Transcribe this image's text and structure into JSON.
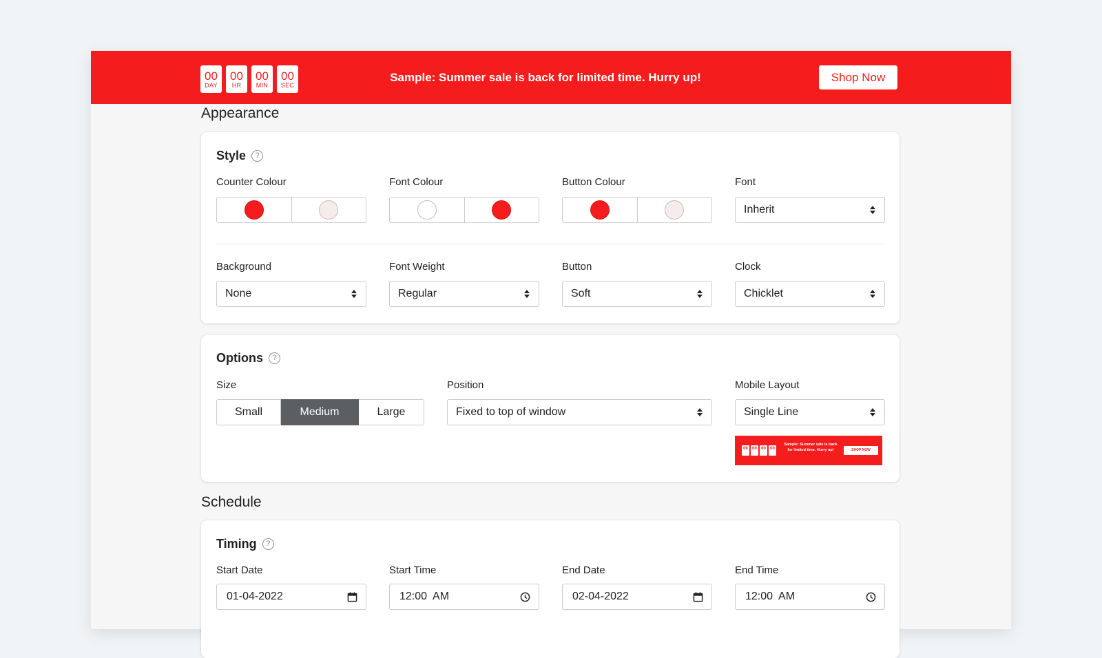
{
  "banner": {
    "counter": [
      {
        "value": "00",
        "unit": "DAY"
      },
      {
        "value": "00",
        "unit": "HR"
      },
      {
        "value": "00",
        "unit": "MIN"
      },
      {
        "value": "00",
        "unit": "SEC"
      }
    ],
    "message": "Sample: Summer sale is back for limited time. Hurry up!",
    "button_label": "Shop Now",
    "color": "#f41c1c"
  },
  "appearance": {
    "title": "Appearance",
    "style": {
      "title": "Style",
      "help_icon": "question-circle-icon",
      "counter_colour": {
        "label": "Counter Colour",
        "colors": [
          "#f41c1c",
          "#f7ecec"
        ]
      },
      "font_colour": {
        "label": "Font Colour",
        "colors": [
          "#ffffff",
          "#f41c1c"
        ]
      },
      "button_colour": {
        "label": "Button Colour",
        "colors": [
          "#f41c1c",
          "#f7ecec"
        ]
      },
      "font": {
        "label": "Font",
        "value": "Inherit"
      },
      "background": {
        "label": "Background",
        "value": "None"
      },
      "font_weight": {
        "label": "Font Weight",
        "value": "Regular"
      },
      "button": {
        "label": "Button",
        "value": "Soft"
      },
      "clock": {
        "label": "Clock",
        "value": "Chicklet"
      }
    },
    "options": {
      "title": "Options",
      "help_icon": "question-circle-icon",
      "size": {
        "label": "Size",
        "options": [
          "Small",
          "Medium",
          "Large"
        ],
        "selected": "Medium"
      },
      "position": {
        "label": "Position",
        "value": "Fixed to top of window"
      },
      "mobile_layout": {
        "label": "Mobile Layout",
        "value": "Single Line",
        "preview": {
          "counter": [
            "00",
            "00",
            "00",
            "00"
          ],
          "message": "Sample: Summer sale is back for limited time. Hurry up!",
          "button": "SHOP NOW"
        }
      }
    }
  },
  "schedule": {
    "title": "Schedule",
    "timing": {
      "title": "Timing",
      "help_icon": "question-circle-icon",
      "start_date": {
        "label": "Start Date",
        "value": "01-04-2022",
        "icon": "calendar-icon"
      },
      "start_time": {
        "label": "Start Time",
        "value": "12:00  AM",
        "icon": "clock-icon"
      },
      "end_date": {
        "label": "End Date",
        "value": "02-04-2022",
        "icon": "calendar-icon"
      },
      "end_time": {
        "label": "End Time",
        "value": "12:00  AM",
        "icon": "clock-icon"
      }
    }
  }
}
